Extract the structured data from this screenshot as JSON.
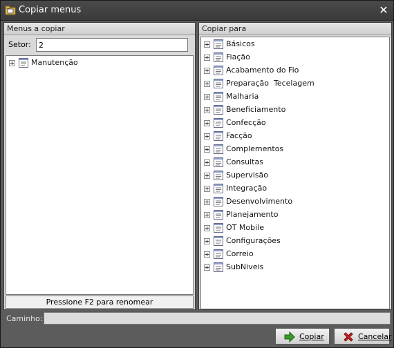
{
  "window": {
    "title": "Copiar menus"
  },
  "left_panel": {
    "header": "Menus a copiar",
    "setor_label": "Setor:",
    "setor_value": "2",
    "items": [
      "Manutenção"
    ],
    "hint": "Pressione F2 para renomear"
  },
  "right_panel": {
    "header": "Copiar para",
    "items": [
      "Básicos",
      "Fiação",
      "Acabamento do Fio",
      "Preparação  Tecelagem",
      "Malharia",
      "Beneficiamento",
      "Confecção",
      "Facção",
      "Complementos",
      "Consultas",
      "Supervisão",
      "Integração",
      "Desenvolvimento",
      "Planejamento",
      "OT Mobile",
      "Configurações",
      "Correio",
      "SubNiveis"
    ]
  },
  "footer": {
    "path_label": "Caminho:",
    "path_value": "",
    "copy_label": "Copiar",
    "cancel_label": "Cancelar"
  },
  "icons": {
    "window": "folder-icon",
    "node": "menu-node-icon",
    "copy": "arrow-right-icon",
    "cancel": "x-mark-icon"
  },
  "colors": {
    "copy_arrow": "#3a9a2a",
    "cancel_x": "#cc2020"
  }
}
